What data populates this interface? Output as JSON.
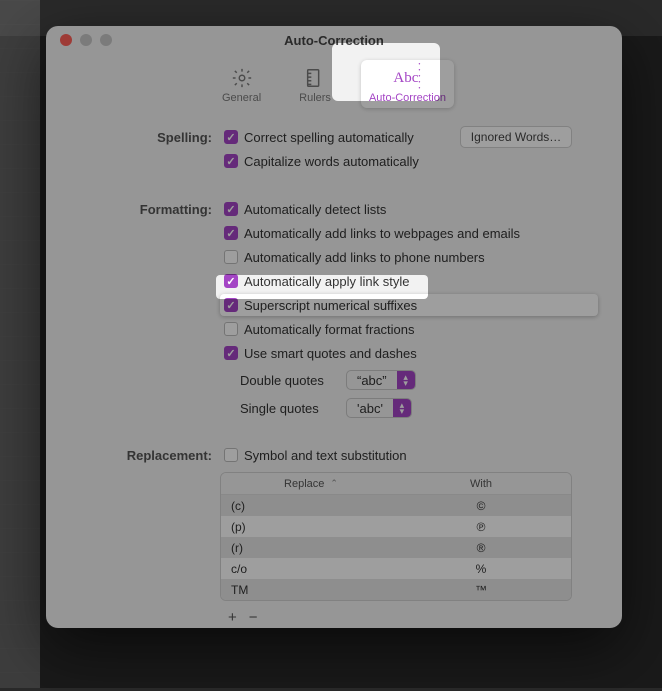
{
  "window_title": "Auto-Correction",
  "tabs": {
    "general": "General",
    "rulers": "Rulers",
    "auto": "Auto-Correction"
  },
  "sections": {
    "spelling": {
      "label": "Spelling:",
      "opt_correct": "Correct spelling automatically",
      "opt_capitalize": "Capitalize words automatically",
      "ignored_btn": "Ignored Words…"
    },
    "formatting": {
      "label": "Formatting:",
      "opt_lists": "Automatically detect lists",
      "opt_links_web": "Automatically add links to webpages and emails",
      "opt_links_phone": "Automatically add links to phone numbers",
      "opt_link_style": "Automatically apply link style",
      "opt_superscript": "Superscript numerical suffixes",
      "opt_fractions": "Automatically format fractions",
      "opt_smart": "Use smart quotes and dashes",
      "double_quotes_label": "Double quotes",
      "double_quotes_value": "“abc”",
      "single_quotes_label": "Single quotes",
      "single_quotes_value": "'abc'"
    },
    "replacement": {
      "label": "Replacement:",
      "opt_symbol": "Symbol and text substitution",
      "col_replace": "Replace",
      "col_with": "With",
      "rows": [
        {
          "replace": "(c)",
          "with": "©"
        },
        {
          "replace": "(p)",
          "with": "℗"
        },
        {
          "replace": "(r)",
          "with": "®"
        },
        {
          "replace": "c/o",
          "with": "%"
        },
        {
          "replace": "TM",
          "with": "™"
        }
      ]
    }
  }
}
